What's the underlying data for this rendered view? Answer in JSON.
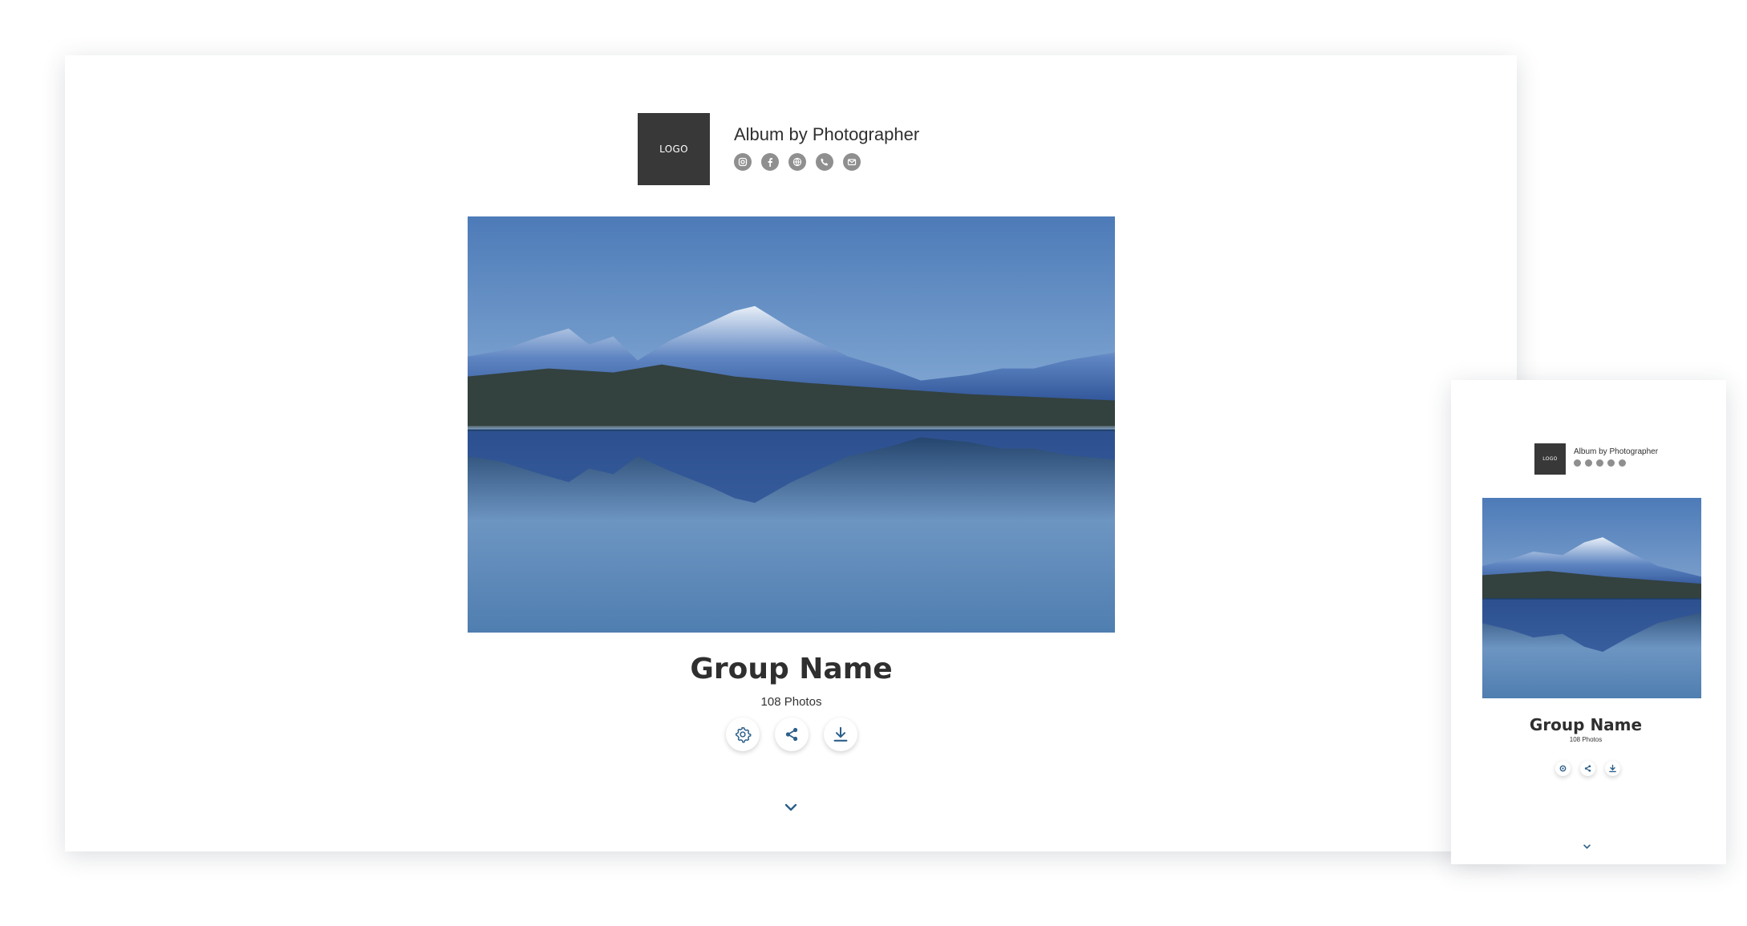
{
  "album": {
    "logo_text": "LOGO",
    "title": "Album by Photographer",
    "social_icons": [
      "instagram-icon",
      "facebook-icon",
      "website-icon",
      "phone-icon",
      "email-icon"
    ],
    "group_name": "Group Name",
    "photo_count": "108 Photos",
    "actions": [
      "settings-icon",
      "share-icon",
      "download-icon"
    ],
    "scroll_icon": "chevron-down-icon"
  },
  "colors": {
    "logo_bg": "#383838",
    "social_icon_bg": "#8f8f8f",
    "action_icon": "#2c5f8a",
    "text": "#2f2f2f"
  }
}
